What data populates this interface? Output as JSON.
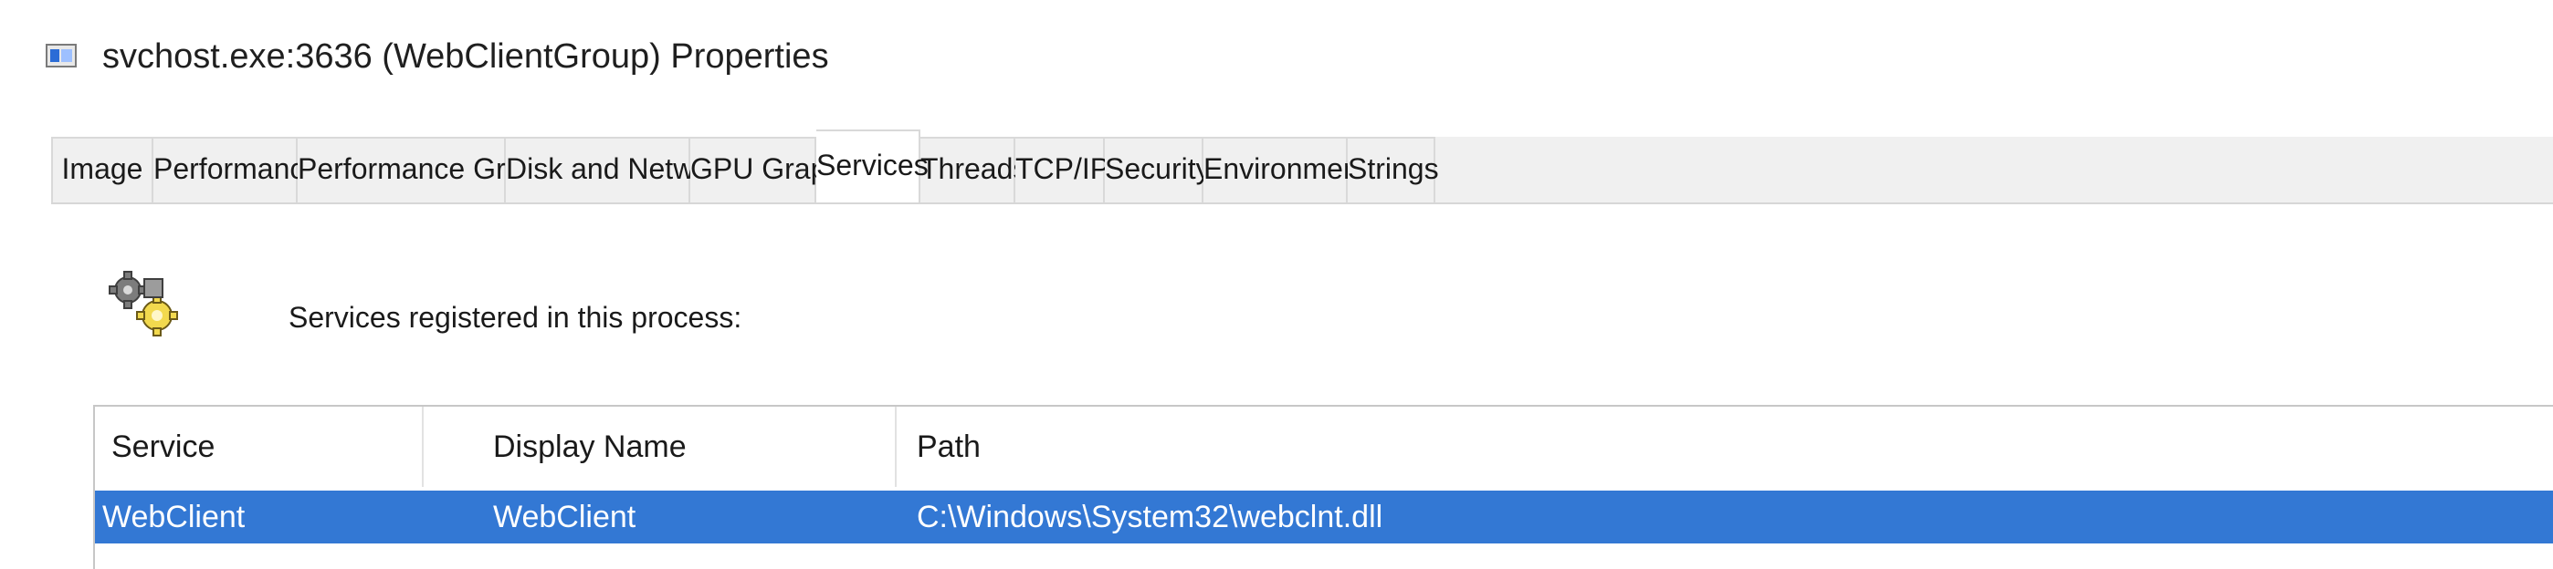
{
  "window": {
    "title": "svchost.exe:3636 (WebClientGroup) Properties",
    "icon": "window-properties-icon"
  },
  "tabs": [
    {
      "label": "Image"
    },
    {
      "label": "Performance"
    },
    {
      "label": "Performance Graph"
    },
    {
      "label": "Disk and Network"
    },
    {
      "label": "GPU Graph"
    },
    {
      "label": "Services",
      "active": true
    },
    {
      "label": "Threads"
    },
    {
      "label": "TCP/IP"
    },
    {
      "label": "Security"
    },
    {
      "label": "Environment"
    },
    {
      "label": "Strings"
    }
  ],
  "services_tab": {
    "icon": "services-gear-icon",
    "intro": "Services registered in this process:",
    "table": {
      "columns": [
        "Service",
        "Display Name",
        "Path"
      ],
      "rows": [
        {
          "service": "WebClient",
          "display_name": "WebClient",
          "path": "C:\\Windows\\System32\\webclnt.dll",
          "selected": true
        }
      ]
    }
  },
  "colors": {
    "selection": "#3378d4",
    "tab_background": "#f0f0f0",
    "active_tab_background": "#ffffff"
  }
}
